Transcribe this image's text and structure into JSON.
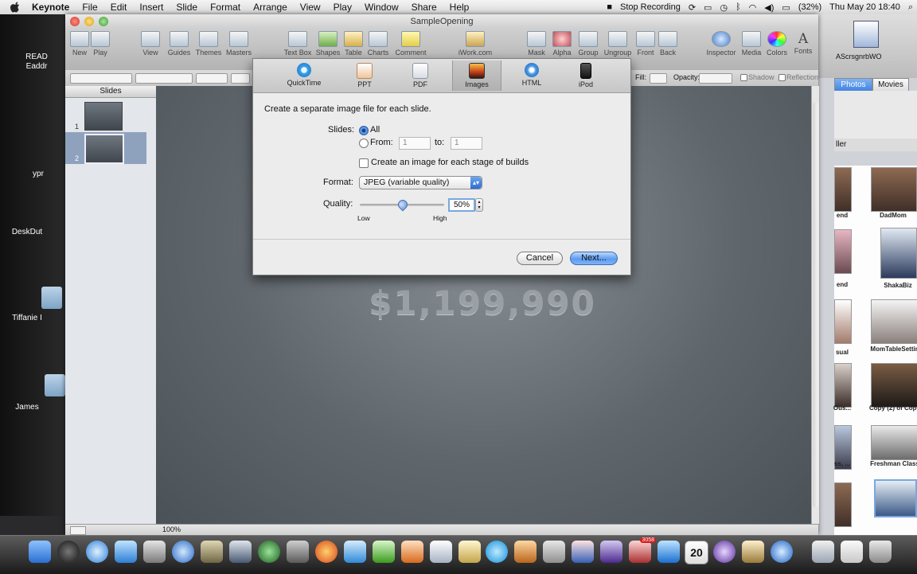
{
  "menubar": {
    "app": "Keynote",
    "items": [
      "File",
      "Edit",
      "Insert",
      "Slide",
      "Format",
      "Arrange",
      "View",
      "Play",
      "Window",
      "Share",
      "Help"
    ],
    "stop_recording": "Stop Recording",
    "battery": "(32%)",
    "datetime": "Thu May 20  18:40"
  },
  "window": {
    "title": "SampleOpening",
    "toolbar": {
      "new": "New",
      "play": "Play",
      "view": "View",
      "guides": "Guides",
      "themes": "Themes",
      "masters": "Masters",
      "text_box": "Text Box",
      "shapes": "Shapes",
      "table": "Table",
      "charts": "Charts",
      "comment": "Comment",
      "iwork": "iWork.com",
      "mask": "Mask",
      "alpha": "Alpha",
      "group": "Group",
      "ungroup": "Ungroup",
      "front": "Front",
      "back": "Back",
      "inspector": "Inspector",
      "media": "Media",
      "colors": "Colors",
      "fonts": "Fonts"
    },
    "formatbar": {
      "fill": "Fill:",
      "opacity": "Opacity:",
      "shadow": "Shadow",
      "reflection": "Reflection"
    },
    "slides_header": "Slides",
    "slide_numbers": [
      "1",
      "2"
    ],
    "zoom": "100%",
    "canvas_text": "$1,199,990"
  },
  "export": {
    "tabs": [
      "QuickTime",
      "PPT",
      "PDF",
      "Images",
      "HTML",
      "iPod"
    ],
    "description": "Create a separate image file for each slide.",
    "slides_label": "Slides:",
    "all_label": "All",
    "from_label": "From:",
    "from_value": "1",
    "to_label": "to:",
    "to_value": "1",
    "builds_label": "Create an image for each stage of builds",
    "format_label": "Format:",
    "format_value": "JPEG (variable quality)",
    "quality_label": "Quality:",
    "quality_value": "50%",
    "quality_level": 0.5,
    "low_label": "Low",
    "high_label": "High",
    "cancel": "Cancel",
    "next": "Next..."
  },
  "desktop": {
    "items": [
      "READ",
      "Eaddr",
      "ypr",
      "DeskDut",
      "Tiffanie I",
      "James"
    ]
  },
  "photo_browser": {
    "tab_photos": "Photos",
    "tab_movies": "Movies",
    "section": "ller",
    "photos": [
      "DadMom",
      "ShakaBiz",
      "MomTableSettin",
      "Copy (2) of Copy",
      "Freshman Class"
    ],
    "partial_labels": [
      "end",
      "end",
      "sual",
      "Ous...",
      "ss, ..."
    ],
    "header_text": "AScrsgnrbWO"
  },
  "dock": {
    "calendar_day": "20",
    "mail_badge": "3058"
  }
}
